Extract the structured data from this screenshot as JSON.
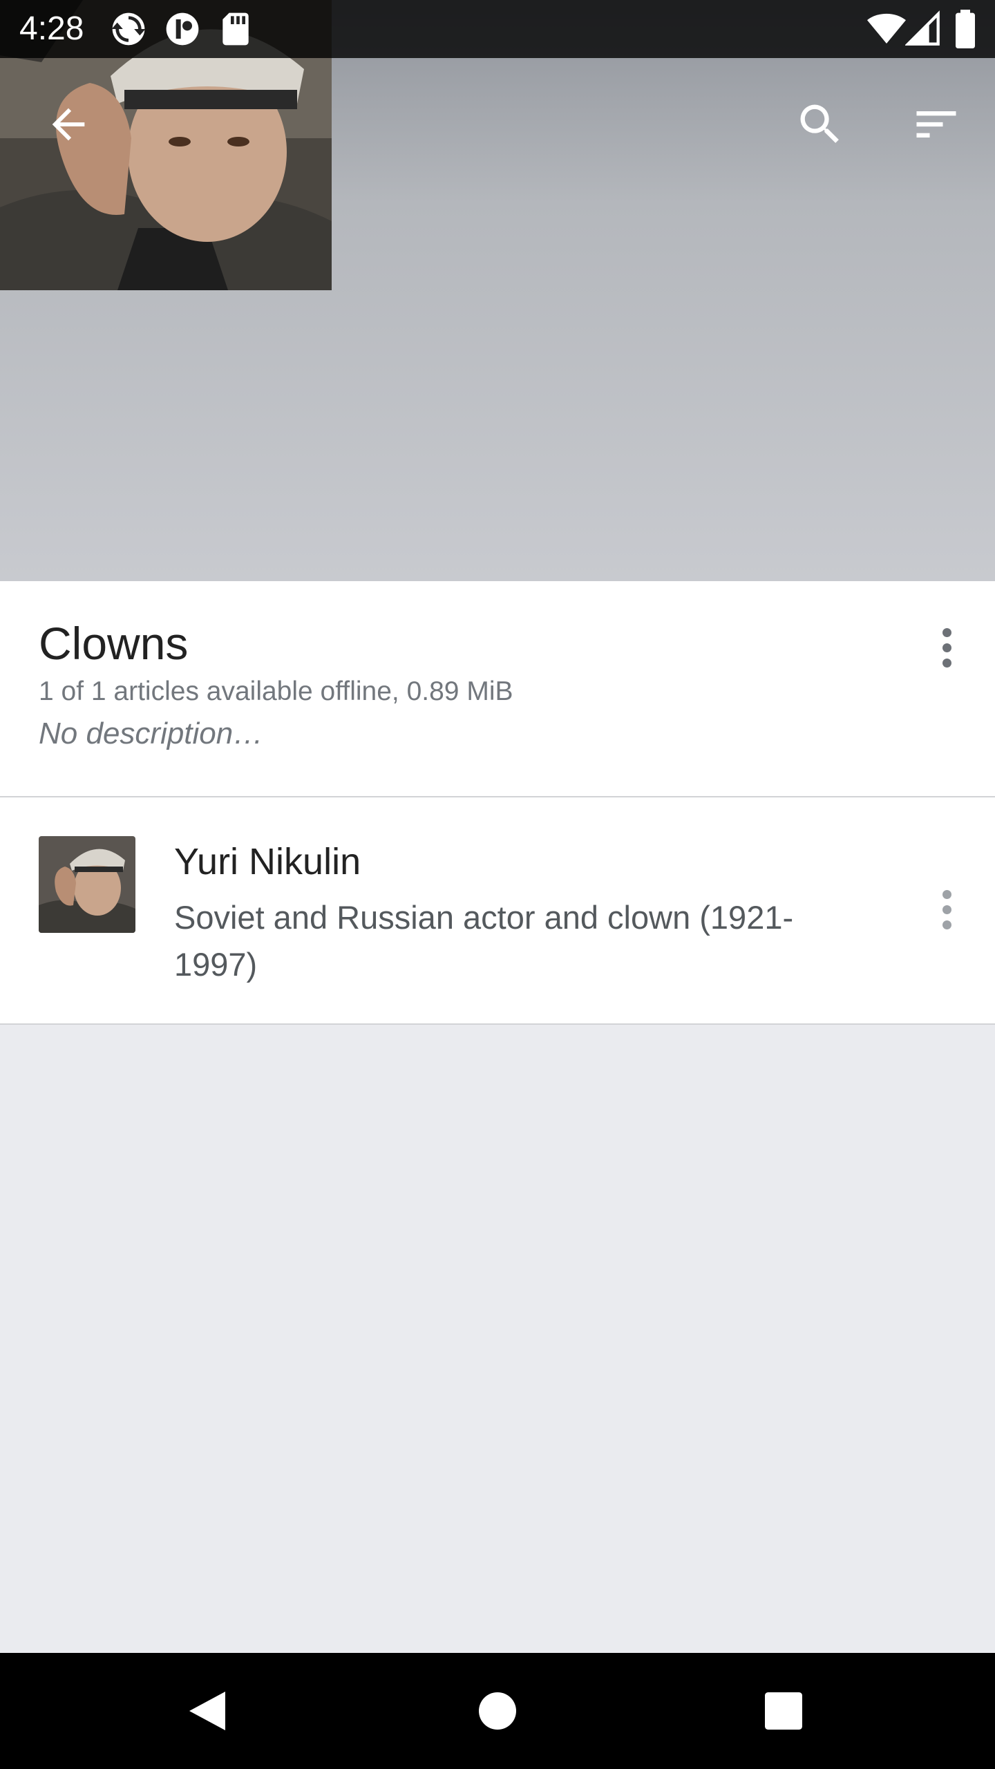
{
  "status_bar": {
    "time": "4:28",
    "notification_icons": [
      "sync-icon",
      "app-notification-icon",
      "sd-card-icon"
    ],
    "system_icons": [
      "wifi-icon",
      "cell-signal-icon",
      "battery-icon"
    ]
  },
  "toolbar": {
    "back_icon": "arrow-back-icon",
    "search_icon": "search-icon",
    "sort_icon": "sort-icon"
  },
  "reading_list": {
    "title": "Clowns",
    "stats": "1 of 1 articles available offline, 0.89 MiB",
    "description": "No description…",
    "overflow_icon": "more-vert-icon"
  },
  "articles": [
    {
      "title": "Yuri Nikulin",
      "description": "Soviet and Russian actor and clown (1921-1997)",
      "overflow_icon": "more-vert-icon"
    }
  ],
  "nav_bar": {
    "buttons": [
      "back-triangle-icon",
      "home-circle-icon",
      "recents-square-icon"
    ]
  },
  "colors": {
    "header_gradient_top": "#90949b",
    "header_gradient_bottom": "#c8cacf",
    "page_background": "#eaebef",
    "card_background": "#ffffff",
    "primary_text": "#222222",
    "secondary_text": "#72777d"
  }
}
